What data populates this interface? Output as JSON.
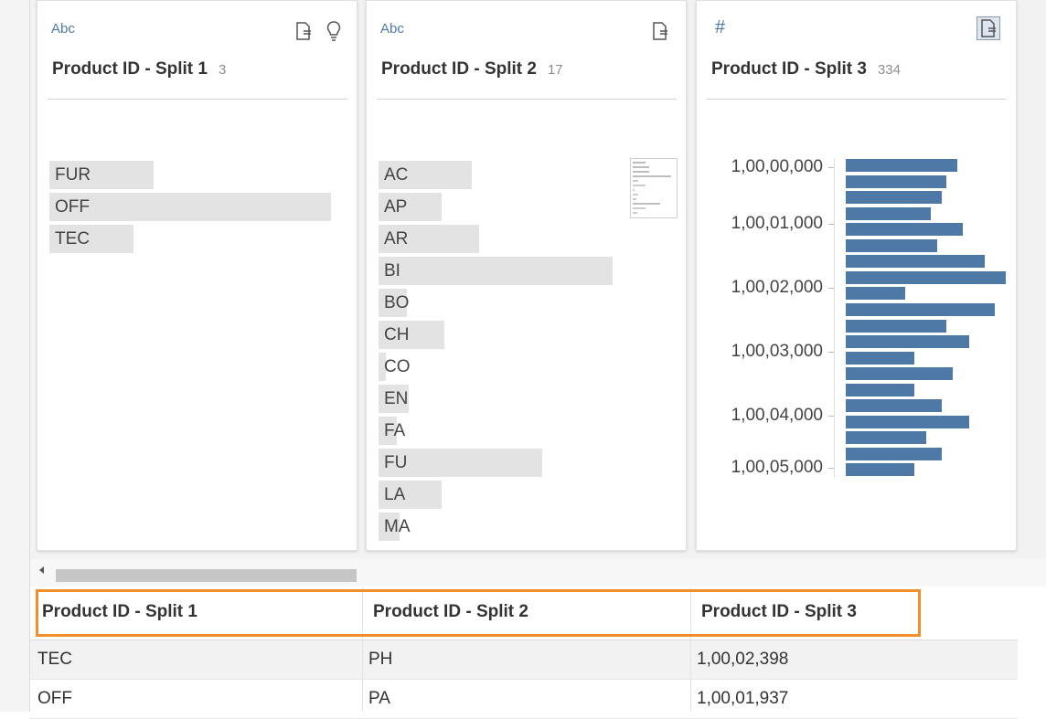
{
  "profile_cards": [
    {
      "type_icon": "Abc",
      "title": "Product ID - Split 1",
      "count": "3",
      "header_icons": [
        "field-options-icon",
        "recommendations-lightbulb-icon"
      ],
      "chart_data": {
        "type": "bar",
        "orientation": "horizontal",
        "categories": [
          "FUR",
          "OFF",
          "TEC"
        ],
        "values": [
          37,
          100,
          30
        ]
      }
    },
    {
      "type_icon": "Abc",
      "title": "Product ID - Split 2",
      "count": "17",
      "header_icons": [
        "field-options-icon"
      ],
      "chart_data": {
        "type": "bar",
        "orientation": "horizontal",
        "categories": [
          "AC",
          "AP",
          "AR",
          "BI",
          "BO",
          "CH",
          "CO",
          "EN",
          "FA",
          "FU",
          "LA",
          "MA"
        ],
        "values": [
          40,
          27,
          43,
          100,
          12,
          28,
          3,
          13,
          8,
          70,
          27,
          9
        ]
      }
    },
    {
      "type_icon": "#",
      "title": "Product ID - Split 3",
      "count": "334",
      "header_icons": [
        "field-options-icon"
      ],
      "axis_labels": [
        "1,00,00,000",
        "1,00,01,000",
        "1,00,02,000",
        "1,00,03,000",
        "1,00,04,000",
        "1,00,05,000"
      ],
      "chart_data": {
        "type": "bar",
        "orientation": "horizontal",
        "bar_color": "#4e79a7",
        "categories": [
          "1,00,00,000",
          "1,00,01,000",
          "1,00,02,000",
          "1,00,03,000",
          "1,00,04,000",
          "1,00,05,000"
        ],
        "values": [
          70,
          63,
          60,
          53,
          73,
          57,
          87,
          100,
          37,
          93,
          63,
          77,
          43,
          67,
          43,
          60,
          77,
          50,
          60,
          43
        ]
      }
    }
  ],
  "grid": {
    "headers": [
      "Product ID - Split 1",
      "Product ID - Split 2",
      "Product ID - Split 3"
    ],
    "rows": [
      [
        "TEC",
        "PH",
        "1,00,02,398"
      ],
      [
        "OFF",
        "PA",
        "1,00,01,937"
      ]
    ]
  },
  "colors": {
    "highlight_border": "#f28e2b",
    "bar_gray": "#e3e3e3",
    "bar_blue": "#4e79a7",
    "type_icon": "#4e79a7"
  }
}
